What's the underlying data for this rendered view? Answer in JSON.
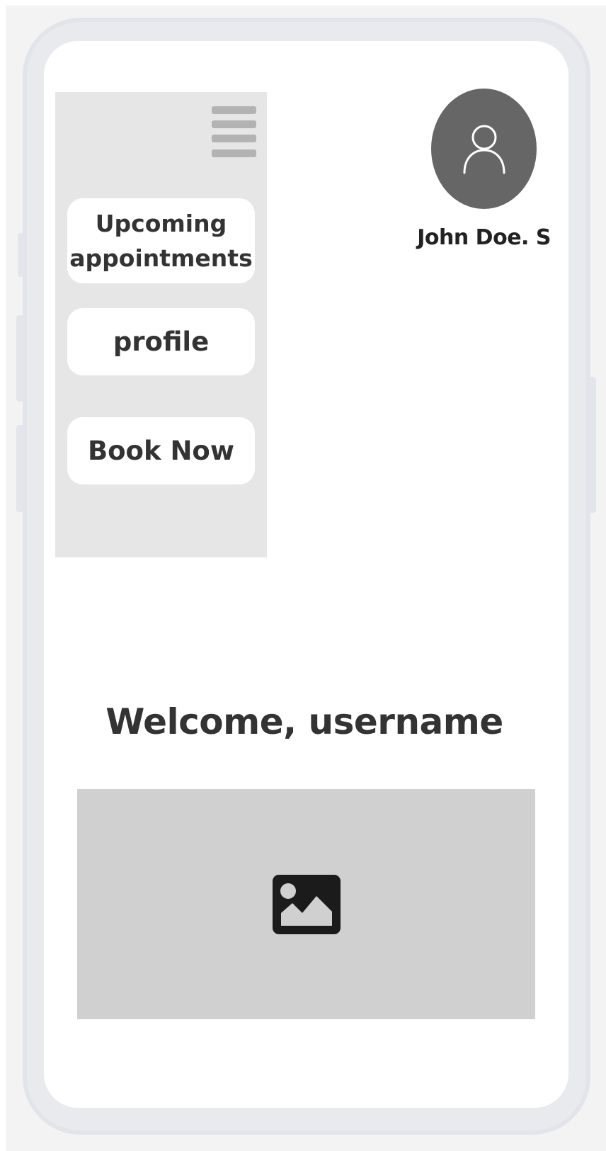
{
  "menu": {
    "icon": "hamburger-menu-icon",
    "items": [
      {
        "label": "Upcoming appointments"
      },
      {
        "label": "profile"
      },
      {
        "label": "Book Now"
      }
    ]
  },
  "user": {
    "avatar_icon": "user-avatar-icon",
    "name": "John Doe. S"
  },
  "main": {
    "welcome_text": "Welcome, username",
    "image_icon": "image-placeholder-icon"
  },
  "colors": {
    "menu_background": "#e6e6e6",
    "avatar_background": "#666666",
    "image_placeholder_background": "#d0d0d0",
    "text": "#333333"
  }
}
